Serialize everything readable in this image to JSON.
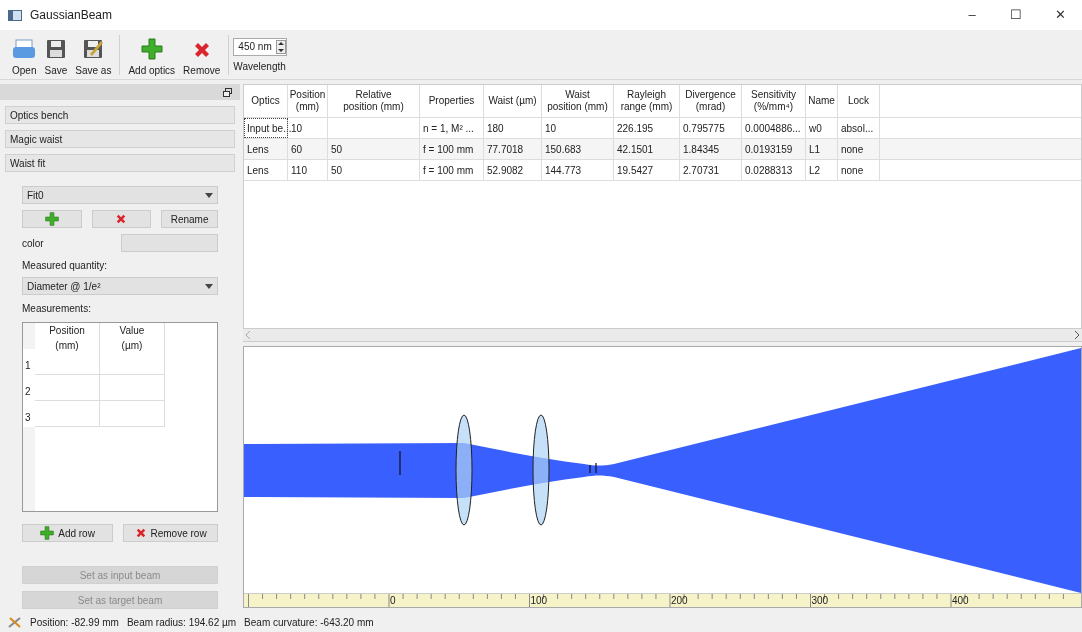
{
  "window": {
    "title": "GaussianBeam",
    "controls": [
      "–",
      "☐",
      "✕"
    ]
  },
  "toolbar": {
    "buttons": [
      {
        "label": "Open",
        "kind": "open"
      },
      {
        "label": "Save",
        "kind": "save"
      },
      {
        "label": "Save as",
        "kind": "saveas"
      },
      {
        "label": "Add optics",
        "kind": "add"
      },
      {
        "label": "Remove",
        "kind": "remove"
      }
    ],
    "wavelength": {
      "value": "450 nm",
      "label": "Wavelength"
    }
  },
  "left_panel": {
    "sections": [
      "Optics bench",
      "Magic waist",
      "Waist fit"
    ],
    "fit_select": "Fit0",
    "rename": "Rename",
    "color_label": "color",
    "quantity_label": "Measured quantity:",
    "quantity_select": "Diameter @ 1/e²",
    "measurements_label": "Measurements:",
    "measurements": {
      "columns": [
        "Position\n(mm)",
        "Value\n(µm)"
      ],
      "rows": [
        "1",
        "2",
        "3"
      ]
    },
    "add_row": "Add row",
    "remove_row": "Remove row",
    "actions": [
      {
        "label": "Set as input beam",
        "disabled": true
      },
      {
        "label": "Set as target beam",
        "disabled": true
      }
    ]
  },
  "table": {
    "columns": [
      "Optics",
      "Position\n(mm)",
      "Relative\nposition (mm)",
      "Properties",
      "Waist (µm)",
      "Waist\nposition (mm)",
      "Rayleigh\nrange (mm)",
      "Divergence\n(mrad)",
      "Sensitivity\n(%/mm⁴)",
      "Name",
      "Lock"
    ],
    "rows": [
      {
        "focused": true,
        "cells": [
          "Input be...",
          "10",
          "",
          "n = 1, M² ...",
          "180",
          "10",
          "226.195",
          "0.795775",
          "0.0004886...",
          "w0",
          "absol..."
        ]
      },
      {
        "focused": false,
        "cells": [
          "Lens",
          "60",
          "50",
          "f = 100 mm",
          "77.7018",
          "150.683",
          "42.1501",
          "1.84345",
          "0.0193159",
          "L1",
          "none"
        ]
      },
      {
        "focused": false,
        "cells": [
          "Lens",
          "110",
          "50",
          "f = 100 mm",
          "52.9082",
          "144.773",
          "19.5427",
          "2.70731",
          "0.0288313",
          "L2",
          "none"
        ]
      }
    ]
  },
  "ruler": {
    "labels": [
      "0",
      "100",
      "200",
      "300",
      "400"
    ]
  },
  "status_bar": [
    "Position: -82.99 mm",
    "Beam radius: 194.62 µm",
    "Beam curvature: -643.20 mm"
  ]
}
